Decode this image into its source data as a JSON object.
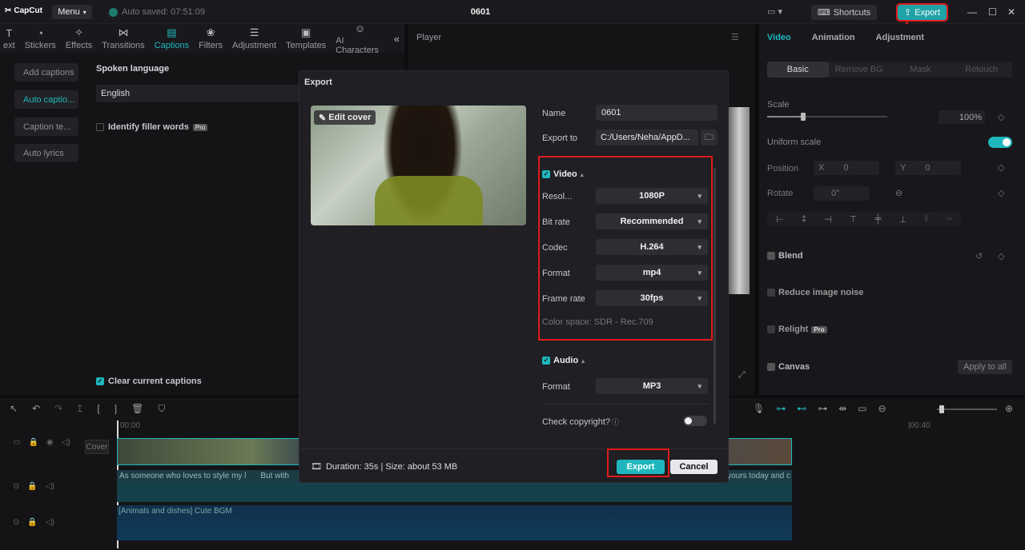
{
  "app": {
    "logo": "CapCut",
    "menu_label": "Menu",
    "autosave": "Auto saved: 07:51:09",
    "project_title": "0601",
    "shortcuts_label": "Shortcuts",
    "export_label": "Export"
  },
  "toolbar_tabs": [
    {
      "label": "ext",
      "icon": "text-icon"
    },
    {
      "label": "Stickers",
      "icon": "sticker-icon"
    },
    {
      "label": "Effects",
      "icon": "effects-icon"
    },
    {
      "label": "Transitions",
      "icon": "transitions-icon"
    },
    {
      "label": "Captions",
      "icon": "captions-icon"
    },
    {
      "label": "Filters",
      "icon": "filters-icon"
    },
    {
      "label": "Adjustment",
      "icon": "adjustment-icon"
    },
    {
      "label": "Templates",
      "icon": "templates-icon"
    },
    {
      "label": "AI Characters",
      "icon": "ai-characters-icon"
    }
  ],
  "left_sidebar": {
    "items": [
      "Add captions",
      "Auto captio...",
      "Caption te...",
      "Auto lyrics"
    ]
  },
  "captions_panel": {
    "spoken_language_label": "Spoken language",
    "spoken_language_value": "English",
    "filler_words_label": "Identify filler words",
    "pro_badge": "Pro",
    "clear_captions_label": "Clear current captions"
  },
  "player": {
    "title": "Player"
  },
  "right_panel": {
    "tabs": [
      "Video",
      "Animation",
      "Adjustment"
    ],
    "subtabs": [
      "Basic",
      "Remove BG",
      "Mask",
      "Retouch"
    ],
    "scale_label": "Scale",
    "scale_value": "100%",
    "scale_level": 0.3,
    "uniform_scale_label": "Uniform scale",
    "position_label": "Position",
    "pos_x_label": "X",
    "pos_x_value": "0",
    "pos_y_label": "Y",
    "pos_y_value": "0",
    "rotate_label": "Rotate",
    "rotate_value": "0°",
    "blend_label": "Blend",
    "reduce_noise_label": "Reduce image noise",
    "relight_label": "Relight",
    "relight_badge": "Pro",
    "canvas_label": "Canvas",
    "apply_all_label": "Apply to all"
  },
  "timeline": {
    "cover_label": "Cover",
    "time_start": "00:00",
    "time_end": "|00:40",
    "caption_texts": [
      "As someone who loves to style my l",
      "But with",
      "yours today and c"
    ],
    "audio_label": "[Animals and dishes] Cute BGM"
  },
  "export_dialog": {
    "title": "Export",
    "edit_cover_label": "Edit cover",
    "name_label": "Name",
    "name_value": "0601",
    "export_to_label": "Export to",
    "export_to_value": "C:/Users/Neha/AppD...",
    "video_section_label": "Video",
    "resolution_label": "Resol...",
    "resolution_value": "1080P",
    "bitrate_label": "Bit rate",
    "bitrate_value": "Recommended",
    "codec_label": "Codec",
    "codec_value": "H.264",
    "format_label": "Format",
    "format_value": "mp4",
    "framerate_label": "Frame rate",
    "framerate_value": "30fps",
    "color_space": "Color space: SDR - Rec.709",
    "audio_section_label": "Audio",
    "audio_format_label": "Format",
    "audio_format_value": "MP3",
    "copyright_label": "Check copyright?",
    "duration_text": "Duration: 35s | Size: about 53 MB",
    "export_button": "Export",
    "cancel_button": "Cancel"
  },
  "colors": {
    "accent": "#1fb7bd",
    "highlight": "#e01b1b",
    "background": "#0d0d0f"
  }
}
